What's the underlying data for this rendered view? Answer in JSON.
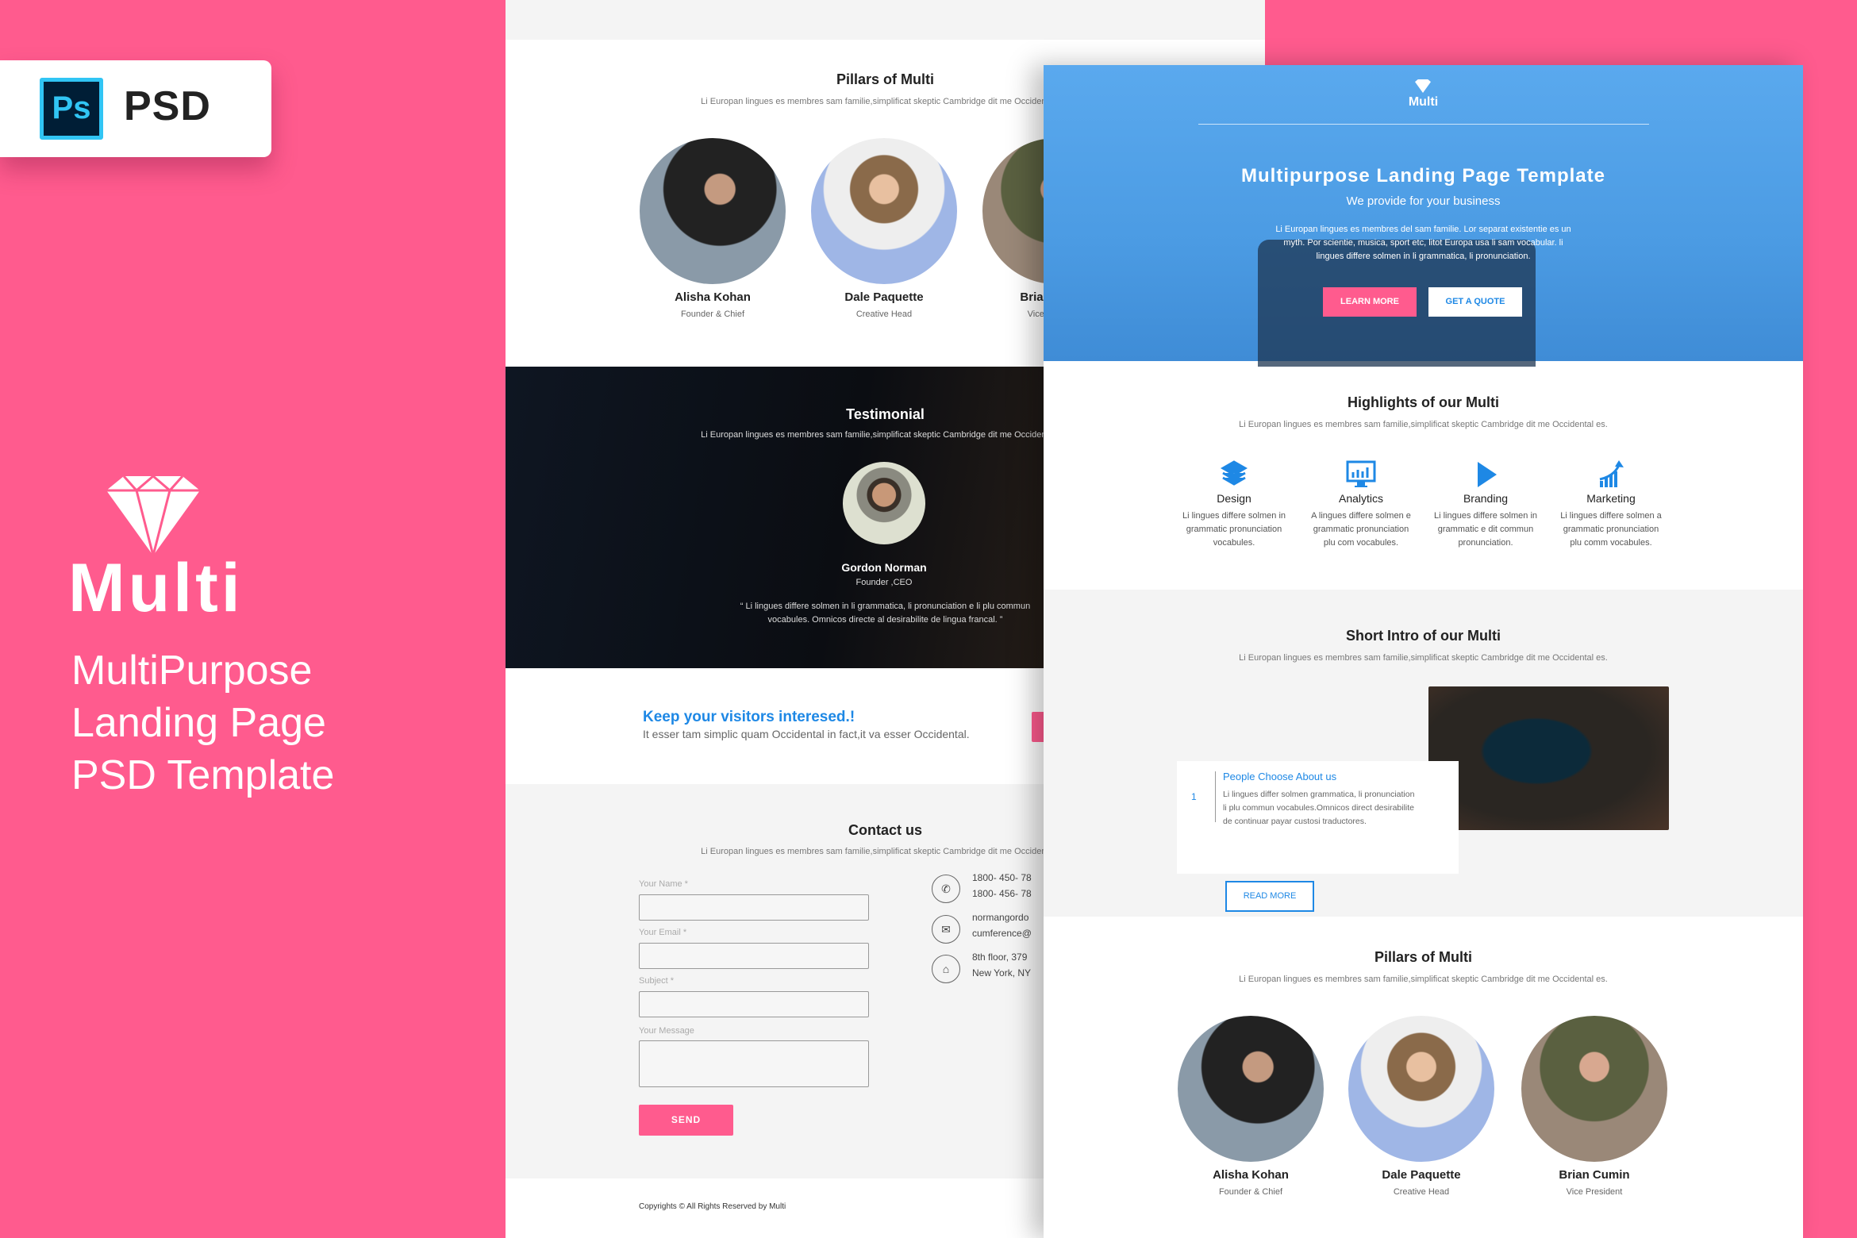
{
  "colors": {
    "pink": "#ff5b8e",
    "blue": "#1e88e5",
    "dark": "#111111"
  },
  "badge": {
    "icon_text": "Ps",
    "label": "PSD"
  },
  "brand": {
    "name": "Multi",
    "tagline": [
      "MultiPurpose",
      "Landing Page",
      "PSD Template"
    ]
  },
  "back_page": {
    "pillars": {
      "title": "Pillars of Multi",
      "subtitle": "Li Europan lingues es membres sam familie,simplificat skeptic Cambridge dit me Occidental es.",
      "people": [
        {
          "name": "Alisha Kohan",
          "role": "Founder & Chief"
        },
        {
          "name": "Dale Paquette",
          "role": "Creative Head"
        },
        {
          "name": "Brian Cumin",
          "role": "Vice President"
        }
      ]
    },
    "testimonial": {
      "title": "Testimonial",
      "subtitle": "Li Europan lingues es membres sam familie,simplificat skeptic Cambridge dit me Occidental es.",
      "name": "Gordon Norman",
      "role": "Founder ,CEO",
      "quote_line1": "“ Li lingues differe solmen in li grammatica, li pronunciation e li plu commun",
      "quote_line2": "vocabules. Omnicos directe al desirabilite de lingua francal. ”"
    },
    "cta": {
      "title": "Keep your visitors interesed.!",
      "text": "It esser tam simplic quam Occidental in fact,it va esser Occidental."
    },
    "contact": {
      "title": "Contact us",
      "subtitle": "Li Europan lingues es membres sam familie,simplificat skeptic Cambridge dit me Occidental es.",
      "labels": {
        "name": "Your Name *",
        "email": "Your Email *",
        "subject": "Subject *",
        "message": "Your Message"
      },
      "send": "SEND",
      "phone": [
        "1800- 450- 78",
        "1800- 456- 78"
      ],
      "email": [
        "normangordo",
        "cumference@"
      ],
      "address": [
        "8th floor, 379",
        "New York, NY"
      ]
    },
    "footer": "Copyrights © All Rights Reserved by Multi"
  },
  "front_page": {
    "hero": {
      "logo": "Multi",
      "title": "Multipurpose Landing Page Template",
      "subtitle": "We provide for your business",
      "para": [
        "Li Europan lingues es membres del sam familie. Lor separat existentie es un",
        "myth. Por scientie, musica, sport etc, litot Europa usa li sam vocabular. li",
        "lingues differe solmen in li grammatica, li pronunciation."
      ],
      "learn_more": "LEARN MORE",
      "get_quote": "GET A QUOTE"
    },
    "highlights": {
      "title": "Highlights of our Multi",
      "subtitle": "Li Europan lingues es membres sam familie,simplificat skeptic Cambridge dit me Occidental es.",
      "items": [
        {
          "icon": "layers-icon",
          "name": "Design",
          "desc": [
            "Li lingues differe solmen in",
            "grammatic pronunciation",
            "vocabules."
          ]
        },
        {
          "icon": "analytics-monitor-icon",
          "name": "Analytics",
          "desc": [
            "A lingues differe solmen e",
            "grammatic pronunciation",
            "plu com vocabules."
          ]
        },
        {
          "icon": "play-icon",
          "name": "Branding",
          "desc": [
            "Li lingues differe solmen in",
            "grammatic  e dit commun",
            "pronunciation."
          ]
        },
        {
          "icon": "growth-chart-icon",
          "name": "Marketing",
          "desc": [
            "Li lingues differe solmen a",
            "grammatic pronunciation",
            "plu comm vocabules."
          ]
        }
      ]
    },
    "intro": {
      "title": "Short Intro of our Multi",
      "subtitle": "Li Europan lingues es membres sam familie,simplificat skeptic Cambridge dit me Occidental es.",
      "number": "1",
      "card_title": "People Choose About us",
      "card_text": [
        "Li lingues differ solmen grammatica, li pronunciation",
        "li plu commun vocabules.Omnicos direct desirabilite",
        "de continuar payar custosi traductores."
      ],
      "read_more": "READ MORE"
    },
    "pillars": {
      "title": "Pillars of Multi",
      "subtitle": "Li Europan lingues es membres sam familie,simplificat skeptic Cambridge dit me Occidental es.",
      "people": [
        {
          "name": "Alisha Kohan",
          "role": "Founder & Chief"
        },
        {
          "name": "Dale Paquette",
          "role": "Creative Head"
        },
        {
          "name": "Brian Cumin",
          "role": "Vice President"
        }
      ]
    }
  }
}
